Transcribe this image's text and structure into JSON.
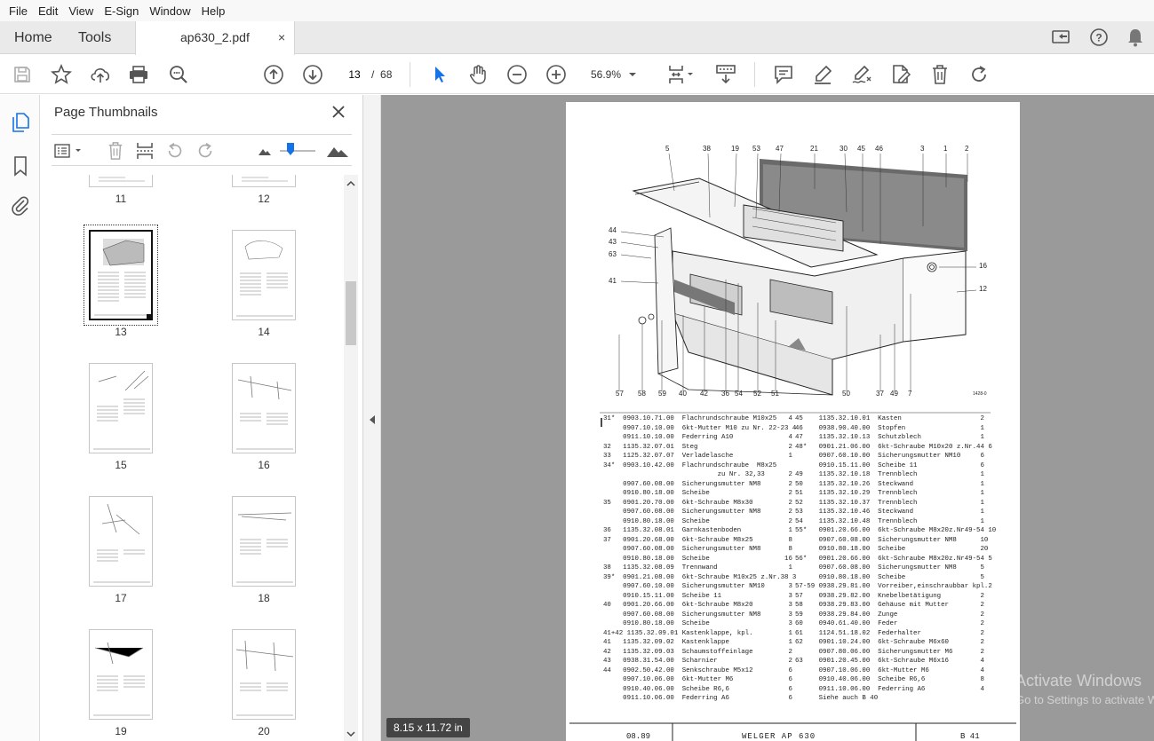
{
  "menu": [
    "File",
    "Edit",
    "View",
    "E-Sign",
    "Window",
    "Help"
  ],
  "tabs": {
    "home": "Home",
    "tools": "Tools",
    "document": "ap630_2.pdf",
    "close": "×"
  },
  "toolbar": {
    "page_current": "13",
    "page_sep": "/",
    "page_total": "68",
    "zoom": "56.9%"
  },
  "panel": {
    "title": "Page Thumbnails",
    "close": "×"
  },
  "thumbnails": [
    "11",
    "12",
    "13",
    "14",
    "15",
    "16",
    "17",
    "18",
    "19",
    "20"
  ],
  "selected_thumbnail": "13",
  "status": {
    "page_size": "8.15 x 11.72 in"
  },
  "watermark": {
    "line1": "Activate Windows",
    "line2": "Go to Settings to activate Windows."
  },
  "document": {
    "callouts_top": [
      "5",
      "38",
      "19",
      "53",
      "47",
      "21",
      "30",
      "45",
      "46",
      "3",
      "1",
      "2"
    ],
    "callouts_left": [
      "44",
      "43",
      "63",
      "41"
    ],
    "callouts_right": [
      "16",
      "12"
    ],
    "callouts_bottom": [
      "57",
      "58",
      "59",
      "40",
      "42",
      "36",
      "54",
      "52",
      "51",
      "50",
      "37",
      "49",
      "7"
    ],
    "drawing_code": "1428-0",
    "parts_left": [
      "31*  0903.10.71.00  Flachrundschraube M10x25   4",
      "     0907.10.10.00  6kt-Mutter M10 zu Nr. 22-23 4",
      "     0911.10.10.00  Federring A10              4",
      "32   1135.32.07.01  Steg                       2",
      "33   1125.32.07.07  Verladelasche              1",
      "34*  0903.10.42.00  Flachrundschraube  M8x25",
      "                             zu Nr. 32,33      2",
      "     0907.60.08.00  Sicherungsmutter NM8       2",
      "     0910.80.18.00  Scheibe                    2",
      "35   0901.20.70.00  6kt-Schraube M8x30         2",
      "     0907.60.08.00  Sicherungsmutter NM8       2",
      "     0910.80.18.00  Scheibe                    2",
      "36   1135.32.08.01  Garnkastenboden            1",
      "37   0901.20.68.00  6kt-Schraube M8x25         8",
      "     0907.60.08.00  Sicherungsmutter NM8       8",
      "     0910.80.18.00  Scheibe                   16",
      "38   1135.32.08.09  Trennwand                  1",
      "39*  0901.21.08.00  6kt-Schraube M10x25 z.Nr.38 3",
      "     0907.60.10.00  Sicherungsmutter NM10      3",
      "     0910.15.11.00  Scheibe 11                 3",
      "40   0901.20.66.00  6kt-Schraube M8x20         3",
      "     0907.60.08.00  Sicherungsmutter NM8       3",
      "     0910.80.18.00  Scheibe                    3",
      "41+42 1135.32.09.01 Kastenklappe, kpl.         1",
      "41   1135.32.09.02  Kastenklappe               1",
      "42   1135.32.09.03  Schaumstoffeinlage         2",
      "43   0938.31.54.00  Scharnier                  2",
      "44   0902.50.42.00  Senkschraube M5x12         6",
      "     0907.10.06.00  6kt-Mutter M6              6",
      "     0910.40.06.00  Scheibe R6,6               6",
      "     0911.10.06.00  Federring A6               6"
    ],
    "parts_right": [
      "45    1135.32.10.01  Kasten                    2",
      "46    0938.90.40.00  Stopfen                   1",
      "47    1135.32.10.13  Schutzblech               1",
      "48*   0901.21.06.00  6kt-Schraube M10x20 z.Nr.44 6",
      "      0907.60.10.00  Sicherungsmutter NM10     6",
      "      0910.15.11.00  Scheibe 11                6",
      "49    1135.32.10.18  Trennblech                1",
      "50    1135.32.10.26  Steckwand                 1",
      "51    1135.32.10.29  Trennblech                1",
      "52    1135.32.10.37  Trennblech                1",
      "53    1135.32.10.46  Steckwand                 1",
      "54    1135.32.10.48  Trennblech                1",
      "55*   0901.20.66.00  6kt-Schraube M8x20z.Nr49-54 10",
      "      0907.60.08.00  Sicherungsmutter NM8      10",
      "      0910.80.18.00  Scheibe                   20",
      "56*   0901.20.66.00  6kt-Schraube M8x20z.Nr49-54 5",
      "      0907.60.08.00  Sicherungsmutter NM8      5",
      "      0910.80.18.00  Scheibe                   5",
      "57-59 0938.29.81.00  Vorreiber,einschraubbar kpl.2",
      "57    0938.29.82.00  Knebelbetätigung          2",
      "58    0938.29.83.00  Gehäuse mit Mutter        2",
      "59    0938.29.84.00  Zunge                     2",
      "60    0940.61.40.00  Feder                     2",
      "61    1124.51.18.02  Federhalter               2",
      "62    0901.10.24.00  6kt-Schraube M6x60        2",
      "      0907.80.06.00  Sicherungsmutter M6       2",
      "63    0901.20.45.00  6kt-Schraube M6x16        4",
      "      0907.10.06.00  6kt-Mutter M6             4",
      "      0910.40.06.00  Scheibe R6,6              8",
      "      0911.10.06.00  Federring A6              4",
      "",
      "      Siehe auch B 40"
    ],
    "footer": {
      "date": "08.89",
      "model": "WELGER AP 630",
      "ref": "B 41"
    }
  }
}
